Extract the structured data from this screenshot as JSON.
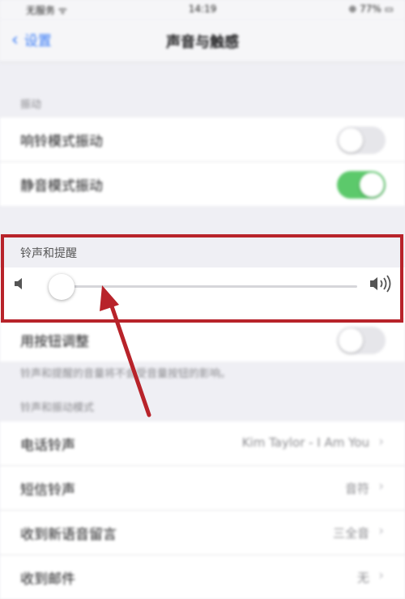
{
  "status_bar": {
    "carrier": "无服务 ᯤ",
    "time": "14:19",
    "battery": "⊕ 77% ▭"
  },
  "nav": {
    "back_label": "设置",
    "title": "声音与触感"
  },
  "vibrate_section": {
    "header": "振动",
    "rows": [
      {
        "label": "响铃模式振动",
        "on": false
      },
      {
        "label": "静音模式振动",
        "on": true
      }
    ]
  },
  "ringer_alerts": {
    "heading": "铃声和提醒",
    "volume_level": 0.0
  },
  "change_with_buttons": {
    "label": "用按钮调整",
    "on": false
  },
  "footnote": "铃声和提醒的音量将不会受音量按钮的影响。",
  "sounds_section": {
    "header": "铃声和振动模式",
    "rows": [
      {
        "label": "电话铃声",
        "value": "Kim Taylor - I Am You"
      },
      {
        "label": "短信铃声",
        "value": "音符"
      },
      {
        "label": "收到新语音留言",
        "value": "三全音"
      },
      {
        "label": "收到邮件",
        "value": "无"
      }
    ]
  },
  "annotation": {
    "color": "#b8232a"
  }
}
